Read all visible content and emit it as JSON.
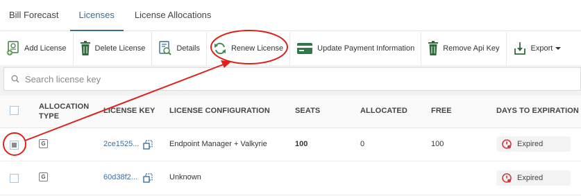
{
  "tabs": [
    {
      "label": "Bill Forecast"
    },
    {
      "label": "Licenses"
    },
    {
      "label": "License Allocations"
    }
  ],
  "toolbar": {
    "add_license": "Add License",
    "delete_license": "Delete License",
    "details": "Details",
    "renew_license": "Renew License",
    "update_payment": "Update Payment Information",
    "remove_api_key": "Remove Api Key",
    "export": "Export"
  },
  "search": {
    "placeholder": "Search license key"
  },
  "table": {
    "columns": {
      "allocation_type": "ALLOCATION TYPE",
      "license_key": "LICENSE KEY",
      "license_configuration": "LICENSE CONFIGURATION",
      "seats": "SEATS",
      "allocated": "ALLOCATED",
      "free": "FREE",
      "days_to_expiration": "DAYS TO EXPIRATION"
    },
    "rows": [
      {
        "type_badge": "G",
        "license_key": "2ce1525...",
        "configuration": "Endpoint Manager + Valkyrie",
        "seats": "100",
        "allocated": "0",
        "free": "100",
        "expiration": "Expired",
        "selected": true
      },
      {
        "type_badge": "G",
        "license_key": "60d38f2...",
        "configuration": "Unknown",
        "seats": "",
        "allocated": "",
        "free": "",
        "expiration": "Expired",
        "selected": false
      }
    ]
  },
  "colors": {
    "accent": "#3a6e8f",
    "annotation_red": "#e0201b",
    "expired_red": "#d9333f"
  }
}
